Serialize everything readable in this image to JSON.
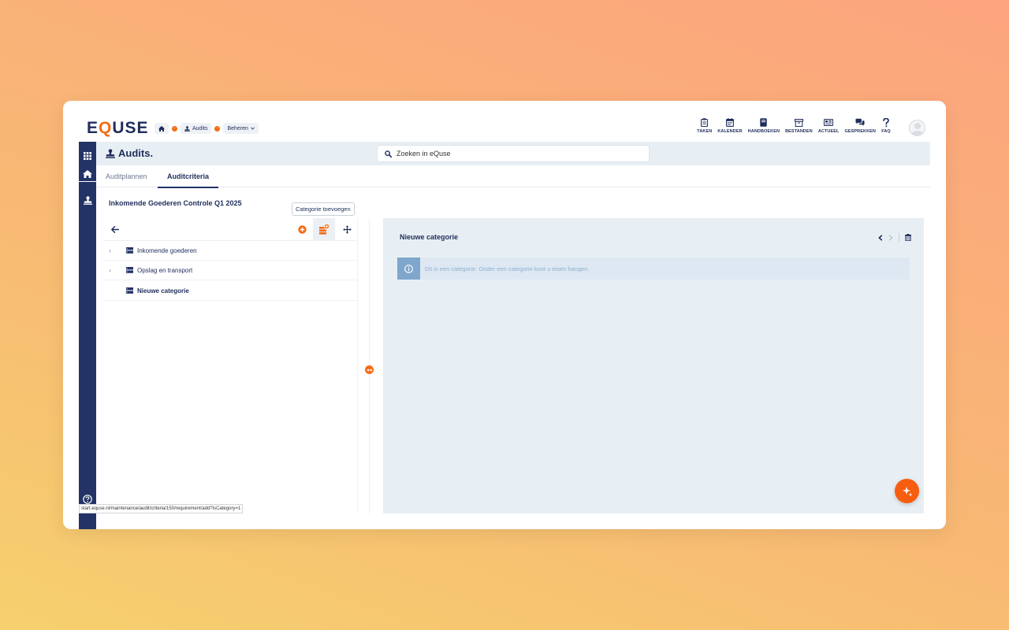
{
  "app": {
    "logo_prefix": "E",
    "logo_q": "Q",
    "logo_suffix": "USE"
  },
  "breadcrumb": {
    "items": [
      {
        "label": "",
        "icon": "home-icon"
      },
      {
        "label": "Audits",
        "icon": "stamp-icon"
      },
      {
        "label": "Beheren",
        "icon": "chevron-down-icon"
      }
    ]
  },
  "topnav": {
    "items": [
      {
        "label": "TAKEN",
        "icon": "clipboard-icon"
      },
      {
        "label": "KALENDER",
        "icon": "calendar-icon"
      },
      {
        "label": "HANDBOEKEN",
        "icon": "book-icon"
      },
      {
        "label": "BESTANDEN",
        "icon": "archive-icon"
      },
      {
        "label": "ACTUEEL",
        "icon": "news-icon"
      },
      {
        "label": "GESPREKKEN",
        "icon": "chat-icon"
      },
      {
        "label": "FAQ",
        "icon": "question-icon"
      }
    ]
  },
  "header": {
    "title": "Audits.",
    "search_placeholder": "Zoeken in eQuse"
  },
  "tabs": [
    {
      "label": "Auditplannen",
      "active": false
    },
    {
      "label": "Auditcriteria",
      "active": true
    }
  ],
  "audit": {
    "title": "Inkomende Goederen Controle Q1 2025"
  },
  "tree": {
    "tooltip": "Categorie toevoegen",
    "items": [
      {
        "label": "Inkomende goederen",
        "expandable": true
      },
      {
        "label": "Opslag en transport",
        "expandable": true
      },
      {
        "label": "Nieuwe categorie",
        "expandable": false,
        "selected": true
      }
    ]
  },
  "detail": {
    "title": "Nieuwe categorie",
    "info_text": "Dit is een categorie. Onder een categorie kunt u eisen hangen."
  },
  "statusbar": {
    "url": "start.equse.nl/maintenance/audit/criteria/150/requirement/add?isCategory=1"
  },
  "colors": {
    "navy": "#233366",
    "accent": "#f46b12",
    "panel_bg": "#e8eff4"
  }
}
